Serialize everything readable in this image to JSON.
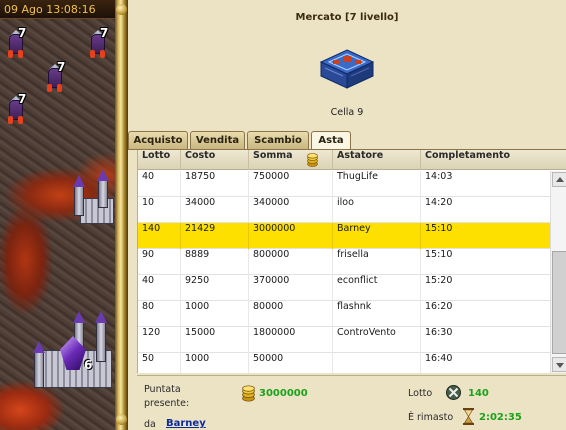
{
  "clock": "09 Ago 13:08:16",
  "map": {
    "units": [
      "7",
      "7",
      "7",
      "7"
    ],
    "city_level": "6"
  },
  "panel": {
    "title": "Mercato [7 livello]",
    "building_name": "Cella 9",
    "building_icon": "market-building-icon"
  },
  "tabs": [
    {
      "label": "Acquisto",
      "active": false
    },
    {
      "label": "Vendita",
      "active": false
    },
    {
      "label": "Scambio",
      "active": false
    },
    {
      "label": "Asta",
      "active": true
    }
  ],
  "table": {
    "headers": [
      "Lotto",
      "Costo",
      "Somma",
      "Astatore",
      "Completamento"
    ],
    "rows": [
      {
        "lotto": "40",
        "costo": "18750",
        "somma": "750000",
        "astatore": "ThugLife",
        "completamento": "14:03",
        "highlight": false
      },
      {
        "lotto": "10",
        "costo": "34000",
        "somma": "340000",
        "astatore": "iloo",
        "completamento": "14:20",
        "highlight": false
      },
      {
        "lotto": "140",
        "costo": "21429",
        "somma": "3000000",
        "astatore": "Barney",
        "completamento": "15:10",
        "highlight": true
      },
      {
        "lotto": "90",
        "costo": "8889",
        "somma": "800000",
        "astatore": "frisella",
        "completamento": "15:10",
        "highlight": false
      },
      {
        "lotto": "40",
        "costo": "9250",
        "somma": "370000",
        "astatore": "econflict",
        "completamento": "15:20",
        "highlight": false
      },
      {
        "lotto": "80",
        "costo": "1000",
        "somma": "80000",
        "astatore": "flashnk",
        "completamento": "16:20",
        "highlight": false
      },
      {
        "lotto": "120",
        "costo": "15000",
        "somma": "1800000",
        "astatore": "ControVento",
        "completamento": "16:30",
        "highlight": false
      },
      {
        "lotto": "50",
        "costo": "1000",
        "somma": "50000",
        "astatore": "",
        "completamento": "16:40",
        "highlight": false
      }
    ]
  },
  "footer": {
    "bid_label": "Puntata presente:",
    "bid_value": "3000000",
    "by_label": "da",
    "bidder": "Barney",
    "lot_label": "Lotto",
    "lot_value": "140",
    "remaining_label": "È rimasto",
    "remaining_value": "2:02:35"
  },
  "colors": {
    "highlight_row": "#fde000",
    "value_green": "#1aa21a",
    "link_blue": "#0a2aa0",
    "clock_gold": "#f0c050"
  }
}
